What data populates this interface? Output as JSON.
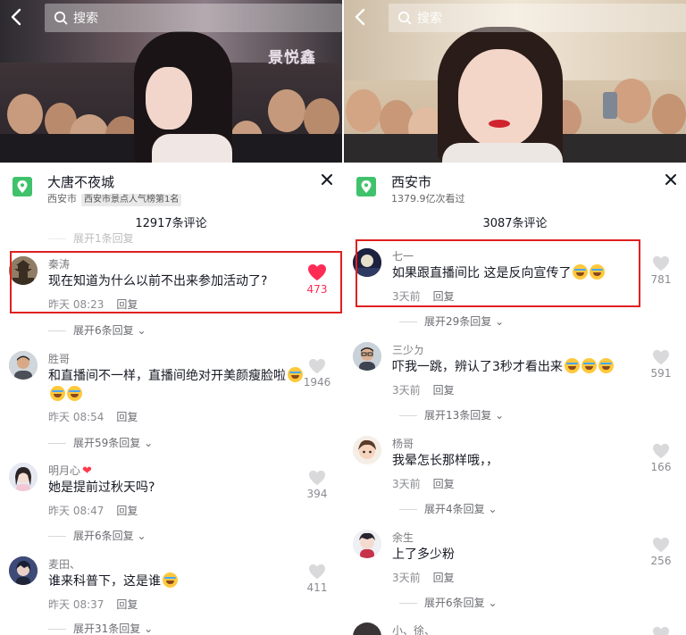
{
  "colors": {
    "highlight": "#e02020",
    "like_active": "#fe2c55",
    "poi_green": "#3fc26b"
  },
  "left": {
    "search": {
      "placeholder": "搜索"
    },
    "background_text": "景悦鑫",
    "poi": {
      "title": "大唐不夜城",
      "city": "西安市",
      "badge": "西安市景点人气榜第1名"
    },
    "comment_count": "12917条评论",
    "comments": [
      {
        "name": "秦涛",
        "text": "现在知道为什么以前不出来参加活动了?",
        "time": "昨天 08:23",
        "reply": "回复",
        "likes": "473",
        "liked": true,
        "expand": "展开6条回复",
        "avatar_icon": "pagoda-avatar"
      },
      {
        "name": "胜哥",
        "text": "和直播间不一样，直播间绝对开美颜瘦脸啦",
        "emojis": 3,
        "time": "昨天 08:54",
        "reply": "回复",
        "likes": "1946",
        "expand": "展开59条回复",
        "avatar_icon": "man-avatar"
      },
      {
        "name": "明月心",
        "name_suffix_icon": "heart-icon",
        "text": "她是提前过秋天吗?",
        "time": "昨天 08:47",
        "reply": "回复",
        "likes": "394",
        "expand": "展开6条回复",
        "avatar_icon": "girl-avatar"
      },
      {
        "name": "麦田、",
        "text": "谁来科普下，这是谁",
        "emojis": 1,
        "time": "昨天 08:37",
        "reply": "回复",
        "likes": "411",
        "expand": "展开31条回复",
        "avatar_icon": "anime-avatar"
      }
    ],
    "partial_expand_top": "展开1条回复"
  },
  "right": {
    "search": {
      "placeholder": "搜索"
    },
    "poi": {
      "title": "西安市",
      "views": "1379.9亿次看过"
    },
    "comment_count": "3087条评论",
    "comments": [
      {
        "name": "七一",
        "text": "如果跟直播间比 这是反向宣传了",
        "emojis": 2,
        "time": "3天前",
        "reply": "回复",
        "likes": "781",
        "expand": "展开29条回复",
        "avatar_icon": "night-sky-avatar"
      },
      {
        "name": "三少ㄉ",
        "text": "吓我一跳，辨认了3秒才看出来",
        "emojis": 3,
        "time": "3天前",
        "reply": "回复",
        "likes": "591",
        "expand": "展开13条回复",
        "avatar_icon": "man-glasses-avatar"
      },
      {
        "name": "杨哥",
        "text": "我晕怎长那样哦，，",
        "time": "3天前",
        "reply": "回复",
        "likes": "166",
        "expand": "展开4条回复",
        "avatar_icon": "cartoon-avatar"
      },
      {
        "name": "余生",
        "text": "上了多少粉",
        "time": "3天前",
        "reply": "回复",
        "likes": "256",
        "expand": "展开6条回复",
        "avatar_icon": "doll-avatar"
      },
      {
        "name": "小、徐、",
        "text": "",
        "time": "",
        "reply": "",
        "likes": "",
        "avatar_icon": "dark-avatar"
      }
    ]
  }
}
